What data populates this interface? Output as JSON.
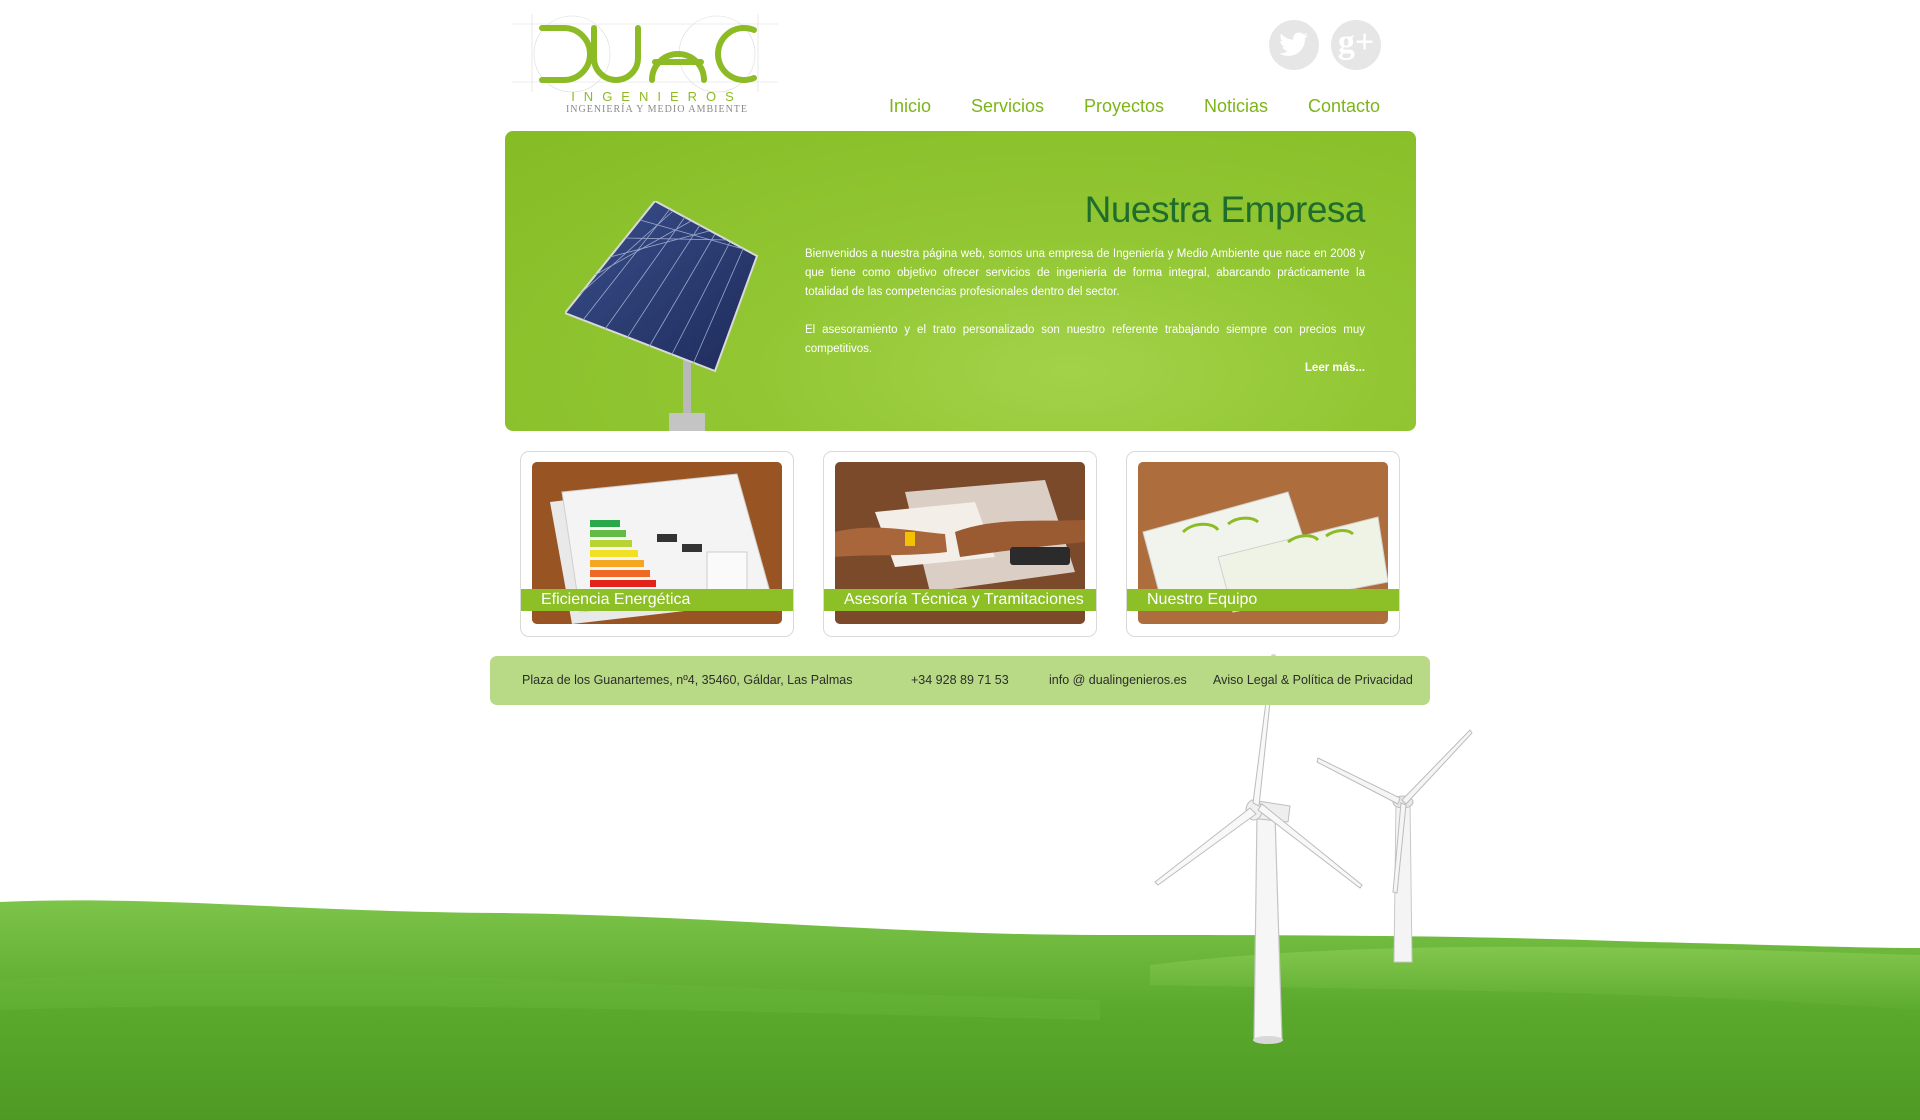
{
  "header": {
    "logo": {
      "wordmark": "DUAL",
      "line1": "INGENIEROS",
      "line2": "INGENIERÍA Y MEDIO AMBIENTE"
    },
    "social": [
      {
        "name": "twitter",
        "icon": "twitter-bird-icon"
      },
      {
        "name": "google-plus",
        "icon": "google-plus-icon",
        "glyph": "g+"
      }
    ],
    "nav": [
      "Inicio",
      "Servicios",
      "Proyectos",
      "Noticias",
      "Contacto"
    ]
  },
  "hero": {
    "title": "Nuestra Empresa",
    "paragraph1": "Bienvenidos a nuestra página web, somos una empresa de Ingeniería y Medio Ambiente que nace en 2008 y que tiene como objetivo ofrecer servicios de ingeniería de forma integral, abarcando prácticamente la totalidad de las competencias profesionales dentro del sector.",
    "paragraph2": "El asesoramiento y el trato personalizado son nuestro referente trabajando siempre con precios muy competitivos.",
    "more": "Leer más..."
  },
  "cards": [
    {
      "label": "Eficiencia Energética",
      "image": "energy-label-photo"
    },
    {
      "label": "Asesoría Técnica y Tramitaciones",
      "image": "desk-paperwork-photo"
    },
    {
      "label": "Nuestro Equipo",
      "image": "business-cards-photo"
    }
  ],
  "footer": {
    "address": "Plaza de los Guanartemes, nº4, 35460, Gáldar, Las Palmas",
    "phone": "+34 928 89 71 53",
    "email": "info @ dualingenieros.es",
    "legal": "Aviso Legal & Política de Privacidad"
  },
  "colors": {
    "brand_green": "#8dbf26",
    "title_green": "#1f6d2c",
    "nav_green": "#7cb518",
    "footer_bg": "#b8d985"
  }
}
